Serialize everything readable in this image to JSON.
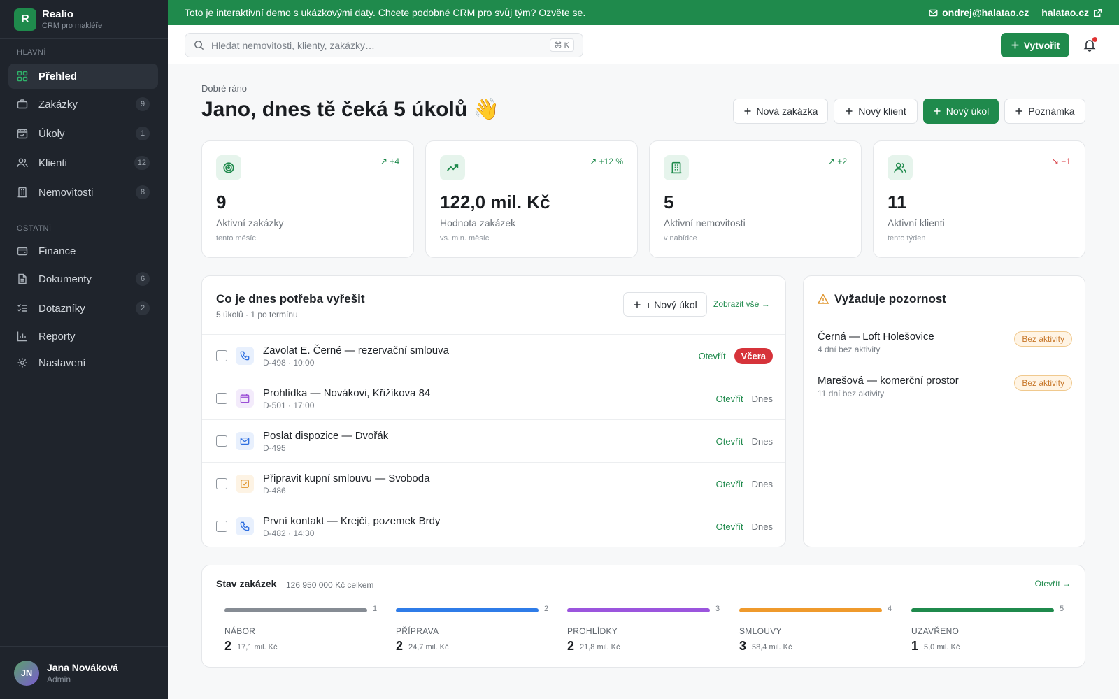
{
  "brand": {
    "logo_letter": "R",
    "name": "Realio",
    "subtitle": "CRM pro makléře"
  },
  "sidebar": {
    "section_main": "HLAVNÍ",
    "section_other": "OSTATNÍ",
    "items": [
      {
        "label": "Přehled",
        "icon": "grid-icon",
        "active": true
      },
      {
        "label": "Zakázky",
        "icon": "briefcase-icon",
        "count": "9"
      },
      {
        "label": "Úkoly",
        "icon": "calendar-check-icon",
        "count": "1"
      },
      {
        "label": "Klienti",
        "icon": "users-icon",
        "count": "12"
      },
      {
        "label": "Nemovitosti",
        "icon": "building-icon",
        "count": "8"
      },
      {
        "label": "Finance",
        "icon": "wallet-icon"
      },
      {
        "label": "Dokumenty",
        "icon": "document-icon",
        "count": "6"
      },
      {
        "label": "Dotazníky",
        "icon": "checklist-icon",
        "count": "2"
      },
      {
        "label": "Reporty",
        "icon": "bar-chart-icon"
      },
      {
        "label": "Nastavení",
        "icon": "gear-icon"
      }
    ]
  },
  "user": {
    "initials": "JN",
    "name": "Jana Nováková",
    "role": "Admin"
  },
  "banner": {
    "text": "Toto je interaktivní demo s ukázkovými daty. Chcete podobné CRM pro svůj tým? Ozvěte se.",
    "email": "ondrej@halatao.cz",
    "site": "halatao.cz"
  },
  "topbar": {
    "search_placeholder": "Hledat nemovitosti, klienty, zakázky…",
    "shortcut": "⌘ K",
    "create_label": "Vytvořit"
  },
  "greeting": {
    "small": "Dobré ráno",
    "title": "Jano, dnes tě čeká 5 úkolů 👋"
  },
  "quick_actions": [
    "Nová zakázka",
    "Nový klient",
    "Nový úkol",
    "Poznámka"
  ],
  "stats": [
    {
      "value": "9",
      "label": "Aktivní zakázky",
      "sub": "tento měsíc",
      "delta": "↗ +4",
      "trend": "up",
      "icon": "target-icon"
    },
    {
      "value": "122,0 mil. Kč",
      "label": "Hodnota zakázek",
      "sub": "vs. min. měsíc",
      "delta": "↗ +12 %",
      "trend": "up",
      "icon": "trending-up-icon"
    },
    {
      "value": "5",
      "label": "Aktivní nemovitosti",
      "sub": "v nabídce",
      "delta": "↗ +2",
      "trend": "up",
      "icon": "building-icon"
    },
    {
      "value": "11",
      "label": "Aktivní klienti",
      "sub": "tento týden",
      "delta": "↘ −1",
      "trend": "down",
      "icon": "users-icon"
    }
  ],
  "tasks": {
    "title": "Co je dnes potřeba vyřešit",
    "subtitle": "5 úkolů · 1 po termínu",
    "new_label": "+ Nový úkol",
    "view_all": "Zobrazit vše →",
    "open_label": "Otevřít",
    "items": [
      {
        "title": "Zavolat E. Černé — rezervační smlouva",
        "meta": "D-498 · 10:00",
        "due": "Včera",
        "overdue": true,
        "icon": "phone-icon",
        "color": "#2f6fe0",
        "bg": "#e8f0fd"
      },
      {
        "title": "Prohlídka — Novákovi, Křižíkova 84",
        "meta": "D-501 · 17:00",
        "due": "Dnes",
        "icon": "calendar-icon",
        "color": "#9b4fd6",
        "bg": "#f3ebfb"
      },
      {
        "title": "Poslat dispozice — Dvořák",
        "meta": "D-495",
        "due": "Dnes",
        "icon": "mail-icon",
        "color": "#2f6fe0",
        "bg": "#e8f0fd"
      },
      {
        "title": "Připravit kupní smlouvu — Svoboda",
        "meta": "D-486",
        "due": "Dnes",
        "icon": "file-check-icon",
        "color": "#e0962f",
        "bg": "#fdf3e4"
      },
      {
        "title": "První kontakt — Krejčí, pozemek Brdy",
        "meta": "D-482 · 14:30",
        "due": "Dnes",
        "icon": "phone-icon",
        "color": "#2f6fe0",
        "bg": "#e8f0fd"
      }
    ]
  },
  "attention": {
    "title": "Vyžaduje pozornost",
    "items": [
      {
        "name": "Černá — Loft Holešovice",
        "meta": "4 dní bez aktivity",
        "badge": "Bez aktivity"
      },
      {
        "name": "Marešová — komerční prostor",
        "meta": "11 dní bez aktivity",
        "badge": "Bez aktivity"
      }
    ]
  },
  "pipeline": {
    "title": "Stav zakázek",
    "total": "126 950 000 Kč celkem",
    "open_label": "Otevřít →",
    "stages": [
      {
        "n": "1",
        "name": "NÁBOR",
        "count": "2",
        "value": "17,1 mil. Kč",
        "color": "#868c94"
      },
      {
        "n": "2",
        "name": "PŘÍPRAVA",
        "count": "2",
        "value": "24,7 mil. Kč",
        "color": "#2f7ce8"
      },
      {
        "n": "3",
        "name": "PROHLÍDKY",
        "count": "2",
        "value": "21,8 mil. Kč",
        "color": "#9b55dd"
      },
      {
        "n": "4",
        "name": "SMLOUVY",
        "count": "3",
        "value": "58,4 mil. Kč",
        "color": "#ef9a2c"
      },
      {
        "n": "5",
        "name": "UZAVŘENO",
        "count": "1",
        "value": "5,0 mil. Kč",
        "color": "#1f8a4c"
      }
    ]
  }
}
